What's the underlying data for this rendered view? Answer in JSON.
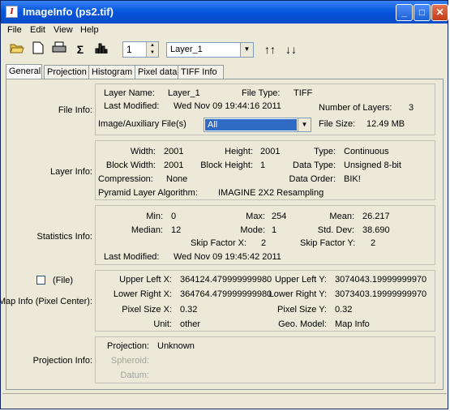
{
  "window": {
    "title": "ImageInfo (ps2.tif)"
  },
  "menu": [
    "File",
    "Edit",
    "View",
    "Help"
  ],
  "toolbar": {
    "layer_number": "1",
    "layer_select": "Layer_1"
  },
  "tabs": [
    "General",
    "Projection",
    "Histogram",
    "Pixel data",
    "TIFF Info"
  ],
  "sections": {
    "file_info": "File Info:",
    "layer_info": "Layer Info:",
    "statistics_info": "Statistics Info:",
    "file_checkbox": "(File)",
    "map_info": "Map Info (Pixel Center):",
    "projection_info": "Projection Info:"
  },
  "file_info": {
    "layer_name_label": "Layer Name:",
    "layer_name": "Layer_1",
    "file_type_label": "File Type:",
    "file_type": "TIFF",
    "last_modified_label": "Last Modified:",
    "last_modified": "Wed Nov 09 19:44:16 2011",
    "num_layers_label": "Number of Layers:",
    "num_layers": "3",
    "aux_files_label": "Image/Auxiliary File(s)",
    "aux_files_value": "All",
    "file_size_label": "File Size:",
    "file_size": "12.49 MB"
  },
  "layer_info": {
    "width_label": "Width:",
    "width": "2001",
    "height_label": "Height:",
    "height": "2001",
    "type_label": "Type:",
    "type": "Continuous",
    "block_width_label": "Block Width:",
    "block_width": "2001",
    "block_height_label": "Block Height:",
    "block_height": "1",
    "data_type_label": "Data Type:",
    "data_type": "Unsigned 8-bit",
    "compression_label": "Compression:",
    "compression": "None",
    "data_order_label": "Data Order:",
    "data_order": "BIK!",
    "pyramid_label": "Pyramid Layer Algorithm:",
    "pyramid": "IMAGINE 2X2 Resampling"
  },
  "statistics": {
    "min_label": "Min:",
    "min": "0",
    "max_label": "Max:",
    "max": "254",
    "mean_label": "Mean:",
    "mean": "26.217",
    "median_label": "Median:",
    "median": "12",
    "mode_label": "Mode:",
    "mode": "1",
    "std_dev_label": "Std. Dev:",
    "std_dev": "38.690",
    "skip_x_label": "Skip Factor X:",
    "skip_x": "2",
    "skip_y_label": "Skip Factor Y:",
    "skip_y": "2",
    "last_modified_label": "Last Modified:",
    "last_modified": "Wed Nov 09 19:45:42 2011"
  },
  "map_info": {
    "ulx_label": "Upper Left X:",
    "ulx": "364124.479999999980",
    "uly_label": "Upper Left Y:",
    "uly": "3074043.19999999970",
    "lrx_label": "Lower Right X:",
    "lrx": "364764.479999999980",
    "lry_label": "Lower Right Y:",
    "lry": "3073403.19999999970",
    "psx_label": "Pixel Size X:",
    "psx": "0.32",
    "psy_label": "Pixel Size Y:",
    "psy": "0.32",
    "unit_label": "Unit:",
    "unit": "other",
    "geo_model_label": "Geo. Model:",
    "geo_model": "Map Info"
  },
  "projection_info": {
    "projection_label": "Projection:",
    "projection": "Unknown",
    "spheroid_label": "Spheroid:",
    "datum_label": "Datum:"
  }
}
